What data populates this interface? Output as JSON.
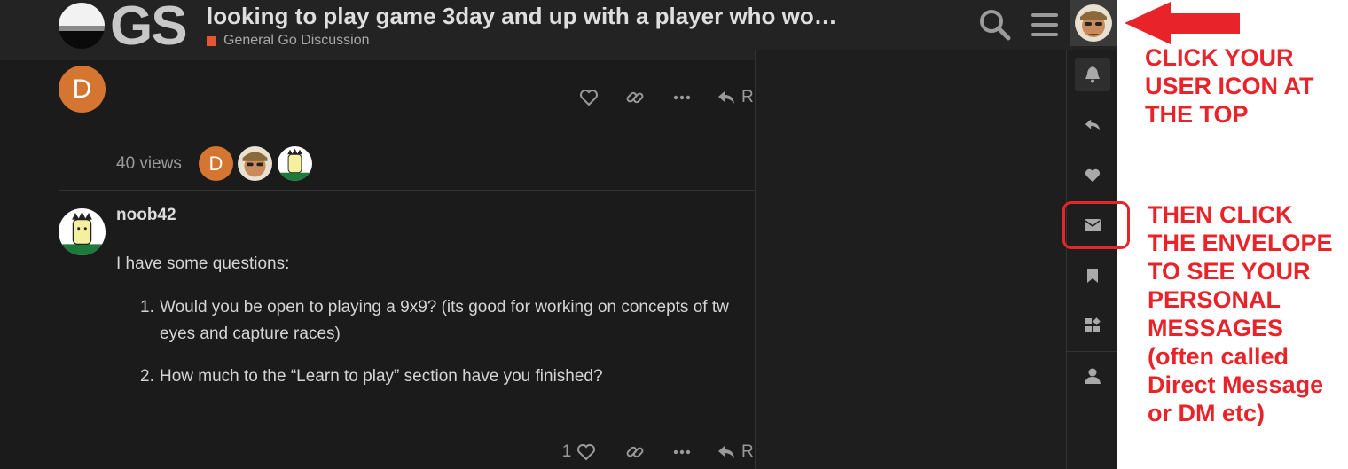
{
  "header": {
    "logo_text": "GS",
    "topic_title": "looking to play game 3day and up with a player who wo…",
    "category": "General Go Discussion",
    "category_color": "#e45735",
    "icons": [
      "search-icon",
      "hamburger-menu-icon",
      "user-avatar-icon"
    ]
  },
  "post1": {
    "author_initial": "D",
    "actions": [
      "heart-icon",
      "link-icon",
      "ellipsis-icon",
      "reply-icon"
    ],
    "reply_label_partial": "R"
  },
  "topic_map": {
    "views": "40 views",
    "participant_initial": "D"
  },
  "post2": {
    "username": "noob42",
    "intro": "I have some questions:",
    "items": [
      {
        "num": "1.",
        "line1": "Would you be open to playing a 9x9? (its good for working on concepts of tw",
        "line2": "eyes and capture races)"
      },
      {
        "num": "2.",
        "line1": "How much to the “Learn to play” section have you finished?"
      }
    ],
    "like_count": "1",
    "reply_label_partial": "R"
  },
  "user_menu": {
    "tabs": [
      "bell-icon",
      "reply-icon",
      "heart-icon",
      "envelope-icon",
      "bookmark-icon",
      "review-icon",
      "profile-icon"
    ],
    "active_tab": "bell-icon"
  },
  "annotations": {
    "first": [
      "CLICK YOUR",
      "USER ICON AT",
      "THE TOP"
    ],
    "second": [
      "THEN CLICK",
      "THE ENVELOPE",
      "TO SEE YOUR",
      "PERSONAL",
      "MESSAGES",
      "(often called",
      "Direct Message",
      "or DM etc)"
    ],
    "color": "#e8242a"
  }
}
